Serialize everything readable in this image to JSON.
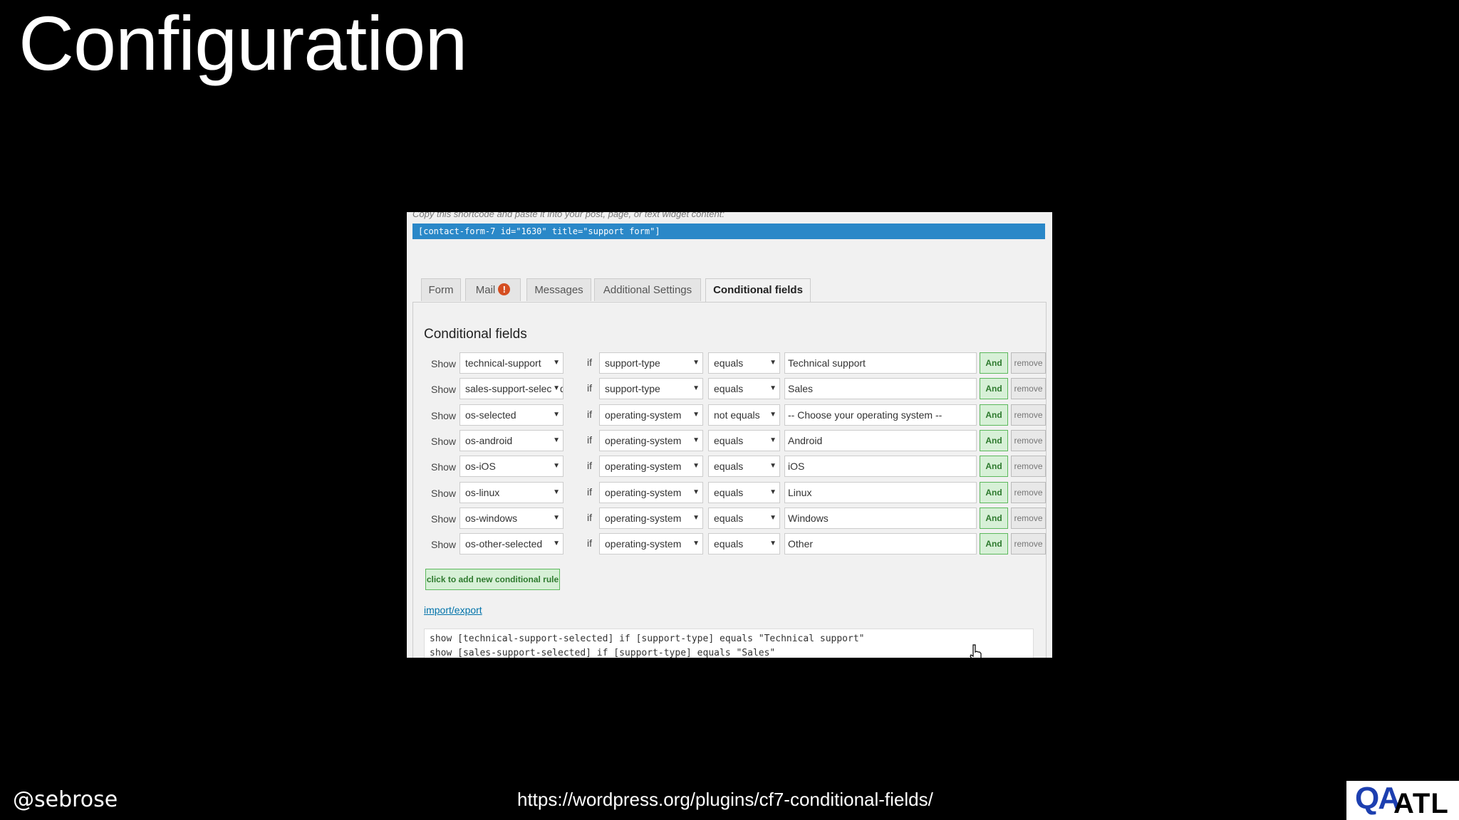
{
  "slide": {
    "title": "Configuration",
    "author": "@sebrose",
    "url": "https://wordpress.org/plugins/cf7-conditional-fields/",
    "logo": {
      "qa": "QA",
      "atl": "ATL"
    }
  },
  "screenshot": {
    "hint": "Copy this shortcode and paste it into your post, page, or text widget content:",
    "shortcode": "[contact-form-7 id=\"1630\" title=\"support form\"]",
    "tabs": [
      {
        "label": "Form"
      },
      {
        "label": "Mail",
        "badge": "!"
      },
      {
        "label": "Messages"
      },
      {
        "label": "Additional Settings"
      },
      {
        "label": "Conditional fields"
      }
    ],
    "active_tab": "Conditional fields",
    "panel_title": "Conditional fields",
    "rules": [
      {
        "show": "Show",
        "target": "technical-support",
        "if": "if",
        "field": "support-type",
        "operator": "equals",
        "value": "Technical support",
        "and": "And",
        "remove": "remove"
      },
      {
        "show": "Show",
        "target": "sales-support-selected",
        "if": "if",
        "field": "support-type",
        "operator": "equals",
        "value": "Sales",
        "and": "And",
        "remove": "remove"
      },
      {
        "show": "Show",
        "target": "os-selected",
        "if": "if",
        "field": "operating-system",
        "operator": "not equals",
        "value": "-- Choose your operating system --",
        "and": "And",
        "remove": "remove"
      },
      {
        "show": "Show",
        "target": "os-android",
        "if": "if",
        "field": "operating-system",
        "operator": "equals",
        "value": "Android",
        "and": "And",
        "remove": "remove"
      },
      {
        "show": "Show",
        "target": "os-iOS",
        "if": "if",
        "field": "operating-system",
        "operator": "equals",
        "value": "iOS",
        "and": "And",
        "remove": "remove"
      },
      {
        "show": "Show",
        "target": "os-linux",
        "if": "if",
        "field": "operating-system",
        "operator": "equals",
        "value": "Linux",
        "and": "And",
        "remove": "remove"
      },
      {
        "show": "Show",
        "target": "os-windows",
        "if": "if",
        "field": "operating-system",
        "operator": "equals",
        "value": "Windows",
        "and": "And",
        "remove": "remove"
      },
      {
        "show": "Show",
        "target": "os-other-selected",
        "if": "if",
        "field": "operating-system",
        "operator": "equals",
        "value": "Other",
        "and": "And",
        "remove": "remove"
      }
    ],
    "add_rule_label": "click to add new conditional rule",
    "import_export_label": "import/export",
    "code_text": "show [technical-support-selected] if [support-type] equals \"Technical support\"\nshow [sales-support-selected] if [support-type] equals \"Sales\""
  },
  "colors": {
    "background": "#000000",
    "shortcode_bar": "#2a88c8",
    "and_button": "#d7f0d7",
    "mail_warning": "#d54e21",
    "logo_qa": "#1d3fb0"
  }
}
